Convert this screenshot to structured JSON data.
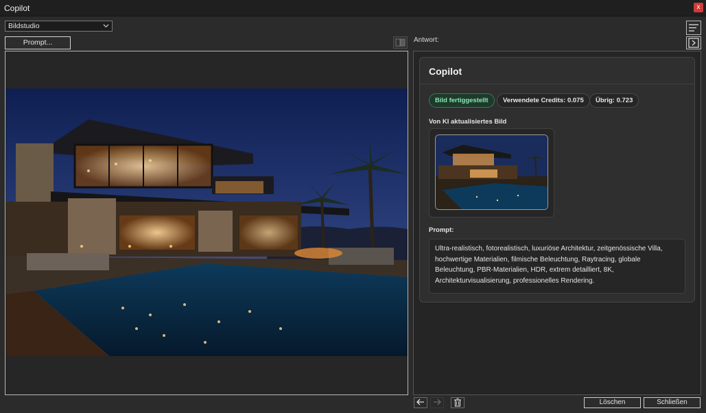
{
  "window": {
    "title": "Copilot",
    "close_glyph": "x"
  },
  "mode_select": {
    "value": "Bildstudio"
  },
  "prompt_button": {
    "label": "Prompt..."
  },
  "answer_label": "Antwort:",
  "result": {
    "title": "Copilot",
    "status": "Bild fertiggestellt",
    "credits_used": "Verwendete Credits: 0.075",
    "remaining": "Übrig: 0.723",
    "image_label": "Von KI aktualisiertes Bild",
    "prompt_label": "Prompt:",
    "prompt_text": "Ultra-realistisch, fotorealistisch, luxuriöse Architektur, zeitgenössische Villa, hochwertige Materialien, filmische Beleuchtung, Raytracing, globale Beleuchtung, PBR-Materialien, HDR, extrem detailliert, 8K, Architekturvisualisierung, professionelles Rendering."
  },
  "footer": {
    "delete_label": "Löschen",
    "close_label": "Schließen"
  },
  "colors": {
    "status_bg": "#1d3a2b",
    "status_text": "#8ce6b0",
    "close_red": "#d23a3a"
  },
  "icons": [
    "chevron-down-icon",
    "compare-icon",
    "menu-icon",
    "panel-toggle-icon",
    "back-arrow-icon",
    "forward-arrow-icon",
    "trash-icon"
  ]
}
